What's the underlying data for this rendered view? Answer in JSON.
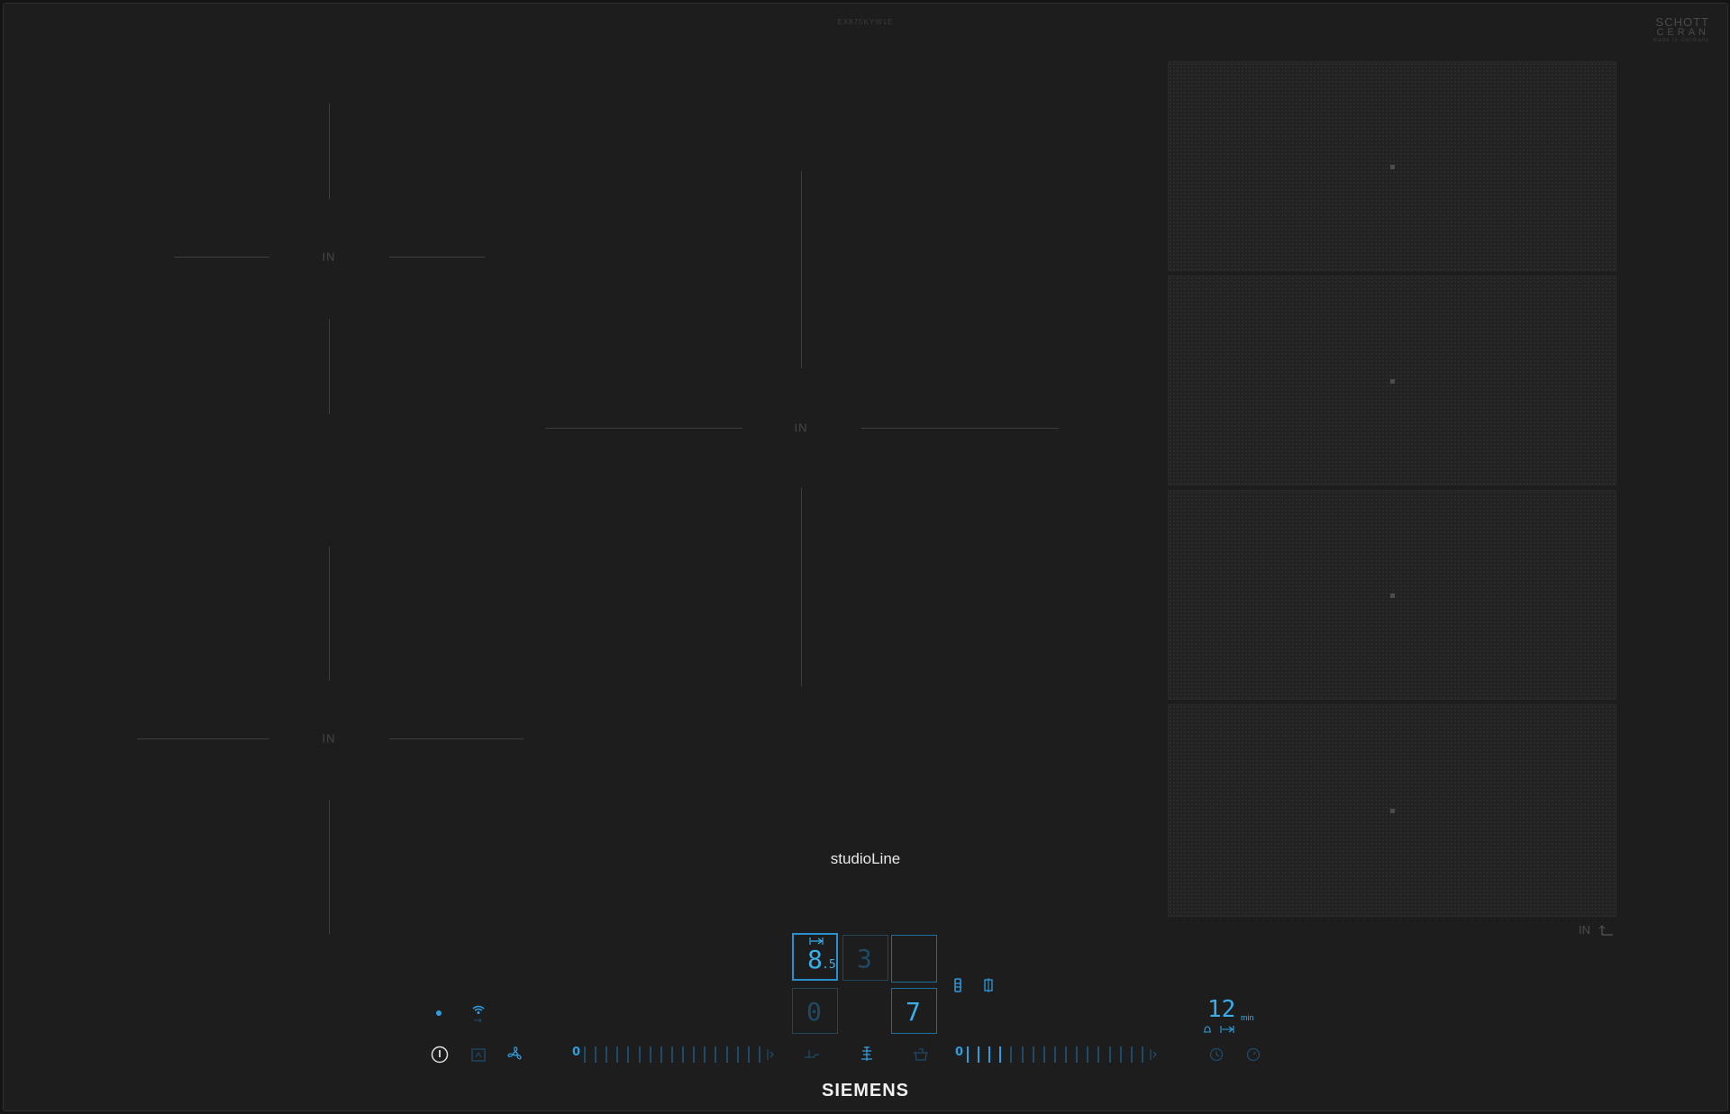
{
  "header": {
    "model_text": "EX875KYW1E"
  },
  "branding": {
    "schott_line1": "SCHOTT",
    "schott_line2": "CERAN",
    "schott_line3": "made in Germany",
    "series": "studioLine",
    "manufacturer": "SIEMENS"
  },
  "zones": {
    "left_top_label": "IN",
    "left_bottom_label": "IN",
    "center_label": "IN"
  },
  "flex_zone": {
    "indicator": "IN",
    "segments": 4
  },
  "control_panel": {
    "display_1_value": "8",
    "display_1_decimal": ".5",
    "display_2_value": "3",
    "display_3_value": "0",
    "display_4_value": "7",
    "left_slider": {
      "zero_label": "0",
      "ticks": 17,
      "level": 0
    },
    "right_slider": {
      "zero_label": "0",
      "ticks": 17,
      "level": 4
    },
    "timer": {
      "value": "12",
      "unit": "min"
    }
  },
  "colors": {
    "accent": "#2f9ee0",
    "accent_dim": "#1e4b6a",
    "glass": "#1d1d1d"
  }
}
